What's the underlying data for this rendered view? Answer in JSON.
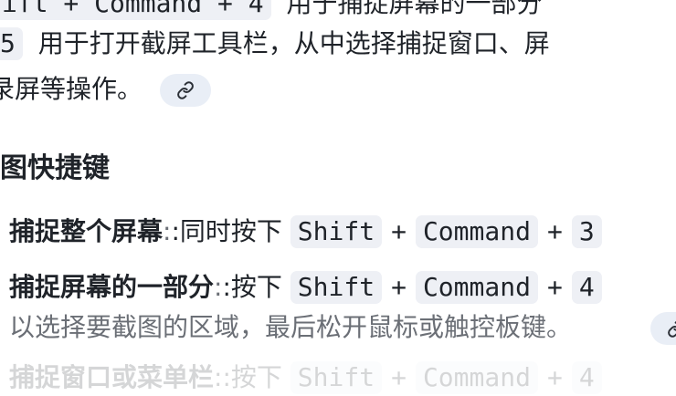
{
  "intro": {
    "line1_key_frag": "ift + Command + 4",
    "line1_text": "用于捕捉屏幕的一部分",
    "line2_key": "5",
    "line2_text": "用于打开截屏工具栏，从中选择捕捉窗口、屏",
    "line3_text": "录屏等操作。"
  },
  "section": {
    "title": "图快捷键"
  },
  "items": [
    {
      "label": "捕捉整个屏幕",
      "sep": ":",
      "lead": ":同时按下",
      "keys": [
        "Shift",
        "Command",
        "3"
      ],
      "plus": "+"
    },
    {
      "label": "捕捉屏幕的一部分",
      "sep": ":",
      "lead": ":按下",
      "keys": [
        "Shift",
        "Command",
        "4"
      ],
      "plus": "+",
      "continuation": "以选择要截图的区域，最后松开鼠标或触控板键。"
    },
    {
      "label": "捕捉窗口或菜单栏",
      "sep": ":",
      "lead": ":按下",
      "keys": [
        "Shift",
        "Command",
        "4"
      ],
      "plus": "+"
    }
  ],
  "icons": {
    "link": "link-icon"
  }
}
